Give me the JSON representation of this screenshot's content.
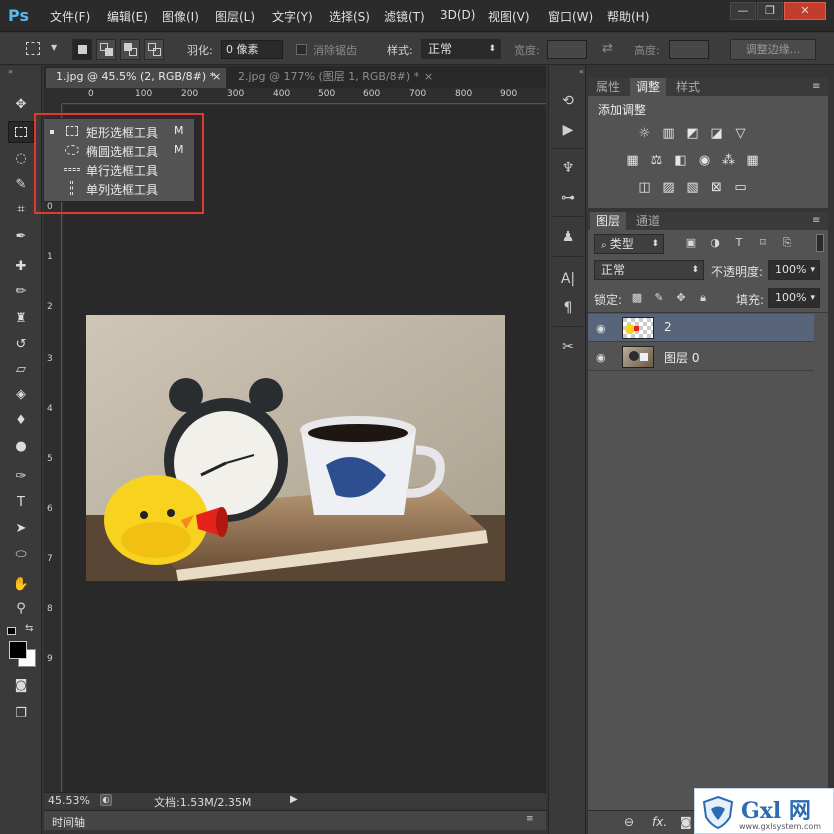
{
  "app": {
    "logo": "Ps"
  },
  "menu": [
    "文件(F)",
    "编辑(E)",
    "图像(I)",
    "图层(L)",
    "文字(Y)",
    "选择(S)",
    "滤镜(T)",
    "3D(D)",
    "视图(V)",
    "窗口(W)",
    "帮助(H)"
  ],
  "window_controls": {
    "minimize": "—",
    "restore": "❐",
    "close": "✕"
  },
  "options": {
    "feather_label": "羽化:",
    "feather_value": "0 像素",
    "antialias_label": "消除锯齿",
    "style_label": "样式:",
    "style_value": "正常",
    "width_label": "宽度:",
    "height_label": "高度:",
    "refine_edge_button": "调整边缘..."
  },
  "tabs": [
    {
      "label": "1.jpg @ 45.5% (2, RGB/8#) *",
      "close": "×"
    },
    {
      "label": "2.jpg @ 177% (图层 1, RGB/8#) *",
      "close": "×"
    }
  ],
  "ruler": {
    "top": [
      "0",
      "100",
      "200",
      "300",
      "400",
      "500",
      "600",
      "700",
      "800",
      "900"
    ],
    "left": [
      "0",
      "1",
      "2",
      "3",
      "4",
      "5",
      "6",
      "7",
      "8",
      "9"
    ]
  },
  "flyout": {
    "items": [
      {
        "label": "矩形选框工具",
        "key": "M",
        "selected": true
      },
      {
        "label": "椭圆选框工具",
        "key": "M",
        "selected": false
      },
      {
        "label": "单行选框工具",
        "key": "",
        "selected": false
      },
      {
        "label": "单列选框工具",
        "key": "",
        "selected": false
      }
    ]
  },
  "status": {
    "zoom": "45.53%",
    "doc": "文档:1.53M/2.35M"
  },
  "timeline": {
    "label": "时间轴"
  },
  "adjust_panel": {
    "tabs": [
      "属性",
      "调整",
      "样式"
    ],
    "active_tab": "调整",
    "title": "添加调整"
  },
  "layers_panel": {
    "tabs": [
      "图层",
      "通道"
    ],
    "filter_value": "类型",
    "blend_mode": "正常",
    "opacity_label": "不透明度:",
    "opacity_value": "100%",
    "lock_label": "锁定:",
    "fill_label": "填充:",
    "fill_value": "100%",
    "layers": [
      {
        "name": "2",
        "selected": true
      },
      {
        "name": "图层 0",
        "selected": false
      }
    ],
    "footer_fx": "fx."
  },
  "watermark": {
    "brand": "Gxl 网",
    "url": "www.gxlsystem.com"
  },
  "colors": {
    "accent": "#5cb6f2",
    "highlight": "#e03a2e",
    "selected_layer": "#576479"
  }
}
